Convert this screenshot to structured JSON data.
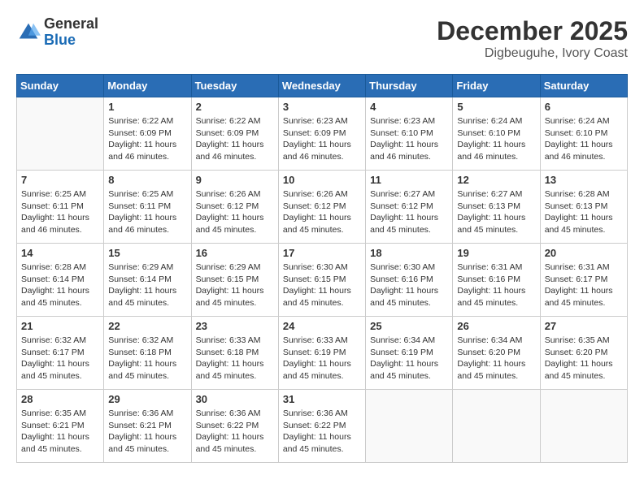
{
  "logo": {
    "general": "General",
    "blue": "Blue"
  },
  "header": {
    "month_year": "December 2025",
    "location": "Digbeuguhe, Ivory Coast"
  },
  "weekdays": [
    "Sunday",
    "Monday",
    "Tuesday",
    "Wednesday",
    "Thursday",
    "Friday",
    "Saturday"
  ],
  "weeks": [
    [
      {
        "day": "",
        "sunrise": "",
        "sunset": "",
        "daylight": ""
      },
      {
        "day": "1",
        "sunrise": "Sunrise: 6:22 AM",
        "sunset": "Sunset: 6:09 PM",
        "daylight": "Daylight: 11 hours and 46 minutes."
      },
      {
        "day": "2",
        "sunrise": "Sunrise: 6:22 AM",
        "sunset": "Sunset: 6:09 PM",
        "daylight": "Daylight: 11 hours and 46 minutes."
      },
      {
        "day": "3",
        "sunrise": "Sunrise: 6:23 AM",
        "sunset": "Sunset: 6:09 PM",
        "daylight": "Daylight: 11 hours and 46 minutes."
      },
      {
        "day": "4",
        "sunrise": "Sunrise: 6:23 AM",
        "sunset": "Sunset: 6:10 PM",
        "daylight": "Daylight: 11 hours and 46 minutes."
      },
      {
        "day": "5",
        "sunrise": "Sunrise: 6:24 AM",
        "sunset": "Sunset: 6:10 PM",
        "daylight": "Daylight: 11 hours and 46 minutes."
      },
      {
        "day": "6",
        "sunrise": "Sunrise: 6:24 AM",
        "sunset": "Sunset: 6:10 PM",
        "daylight": "Daylight: 11 hours and 46 minutes."
      }
    ],
    [
      {
        "day": "7",
        "sunrise": "Sunrise: 6:25 AM",
        "sunset": "Sunset: 6:11 PM",
        "daylight": "Daylight: 11 hours and 46 minutes."
      },
      {
        "day": "8",
        "sunrise": "Sunrise: 6:25 AM",
        "sunset": "Sunset: 6:11 PM",
        "daylight": "Daylight: 11 hours and 46 minutes."
      },
      {
        "day": "9",
        "sunrise": "Sunrise: 6:26 AM",
        "sunset": "Sunset: 6:12 PM",
        "daylight": "Daylight: 11 hours and 45 minutes."
      },
      {
        "day": "10",
        "sunrise": "Sunrise: 6:26 AM",
        "sunset": "Sunset: 6:12 PM",
        "daylight": "Daylight: 11 hours and 45 minutes."
      },
      {
        "day": "11",
        "sunrise": "Sunrise: 6:27 AM",
        "sunset": "Sunset: 6:12 PM",
        "daylight": "Daylight: 11 hours and 45 minutes."
      },
      {
        "day": "12",
        "sunrise": "Sunrise: 6:27 AM",
        "sunset": "Sunset: 6:13 PM",
        "daylight": "Daylight: 11 hours and 45 minutes."
      },
      {
        "day": "13",
        "sunrise": "Sunrise: 6:28 AM",
        "sunset": "Sunset: 6:13 PM",
        "daylight": "Daylight: 11 hours and 45 minutes."
      }
    ],
    [
      {
        "day": "14",
        "sunrise": "Sunrise: 6:28 AM",
        "sunset": "Sunset: 6:14 PM",
        "daylight": "Daylight: 11 hours and 45 minutes."
      },
      {
        "day": "15",
        "sunrise": "Sunrise: 6:29 AM",
        "sunset": "Sunset: 6:14 PM",
        "daylight": "Daylight: 11 hours and 45 minutes."
      },
      {
        "day": "16",
        "sunrise": "Sunrise: 6:29 AM",
        "sunset": "Sunset: 6:15 PM",
        "daylight": "Daylight: 11 hours and 45 minutes."
      },
      {
        "day": "17",
        "sunrise": "Sunrise: 6:30 AM",
        "sunset": "Sunset: 6:15 PM",
        "daylight": "Daylight: 11 hours and 45 minutes."
      },
      {
        "day": "18",
        "sunrise": "Sunrise: 6:30 AM",
        "sunset": "Sunset: 6:16 PM",
        "daylight": "Daylight: 11 hours and 45 minutes."
      },
      {
        "day": "19",
        "sunrise": "Sunrise: 6:31 AM",
        "sunset": "Sunset: 6:16 PM",
        "daylight": "Daylight: 11 hours and 45 minutes."
      },
      {
        "day": "20",
        "sunrise": "Sunrise: 6:31 AM",
        "sunset": "Sunset: 6:17 PM",
        "daylight": "Daylight: 11 hours and 45 minutes."
      }
    ],
    [
      {
        "day": "21",
        "sunrise": "Sunrise: 6:32 AM",
        "sunset": "Sunset: 6:17 PM",
        "daylight": "Daylight: 11 hours and 45 minutes."
      },
      {
        "day": "22",
        "sunrise": "Sunrise: 6:32 AM",
        "sunset": "Sunset: 6:18 PM",
        "daylight": "Daylight: 11 hours and 45 minutes."
      },
      {
        "day": "23",
        "sunrise": "Sunrise: 6:33 AM",
        "sunset": "Sunset: 6:18 PM",
        "daylight": "Daylight: 11 hours and 45 minutes."
      },
      {
        "day": "24",
        "sunrise": "Sunrise: 6:33 AM",
        "sunset": "Sunset: 6:19 PM",
        "daylight": "Daylight: 11 hours and 45 minutes."
      },
      {
        "day": "25",
        "sunrise": "Sunrise: 6:34 AM",
        "sunset": "Sunset: 6:19 PM",
        "daylight": "Daylight: 11 hours and 45 minutes."
      },
      {
        "day": "26",
        "sunrise": "Sunrise: 6:34 AM",
        "sunset": "Sunset: 6:20 PM",
        "daylight": "Daylight: 11 hours and 45 minutes."
      },
      {
        "day": "27",
        "sunrise": "Sunrise: 6:35 AM",
        "sunset": "Sunset: 6:20 PM",
        "daylight": "Daylight: 11 hours and 45 minutes."
      }
    ],
    [
      {
        "day": "28",
        "sunrise": "Sunrise: 6:35 AM",
        "sunset": "Sunset: 6:21 PM",
        "daylight": "Daylight: 11 hours and 45 minutes."
      },
      {
        "day": "29",
        "sunrise": "Sunrise: 6:36 AM",
        "sunset": "Sunset: 6:21 PM",
        "daylight": "Daylight: 11 hours and 45 minutes."
      },
      {
        "day": "30",
        "sunrise": "Sunrise: 6:36 AM",
        "sunset": "Sunset: 6:22 PM",
        "daylight": "Daylight: 11 hours and 45 minutes."
      },
      {
        "day": "31",
        "sunrise": "Sunrise: 6:36 AM",
        "sunset": "Sunset: 6:22 PM",
        "daylight": "Daylight: 11 hours and 45 minutes."
      },
      {
        "day": "",
        "sunrise": "",
        "sunset": "",
        "daylight": ""
      },
      {
        "day": "",
        "sunrise": "",
        "sunset": "",
        "daylight": ""
      },
      {
        "day": "",
        "sunrise": "",
        "sunset": "",
        "daylight": ""
      }
    ]
  ]
}
